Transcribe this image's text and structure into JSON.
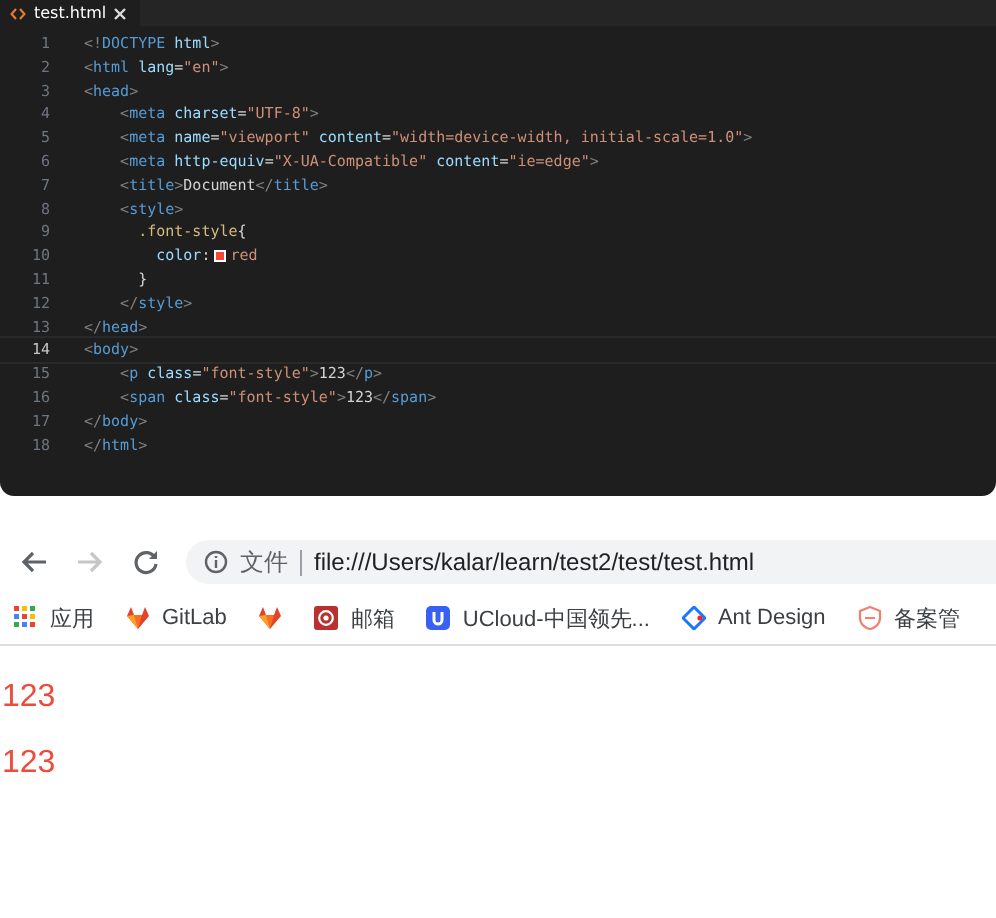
{
  "editor": {
    "tabs": [
      {
        "label": "test.html",
        "selected": true
      }
    ],
    "code_lines": [
      {
        "number": "1",
        "current": false,
        "tokens": [
          {
            "kind": "punct",
            "text": "<!"
          },
          {
            "kind": "tag",
            "text": "DOCTYPE"
          },
          {
            "kind": "attr",
            "text": " html"
          },
          {
            "kind": "punct",
            "text": ">"
          }
        ]
      },
      {
        "number": "2",
        "current": false,
        "tokens": [
          {
            "kind": "punct",
            "text": "<"
          },
          {
            "kind": "tag",
            "text": "html"
          },
          {
            "kind": "attr",
            "text": " lang"
          },
          {
            "kind": "plain",
            "text": "="
          },
          {
            "kind": "string",
            "text": "\"en\""
          },
          {
            "kind": "punct",
            "text": ">"
          }
        ]
      },
      {
        "number": "3",
        "current": false,
        "tokens": [
          {
            "kind": "punct",
            "text": "<"
          },
          {
            "kind": "tag",
            "text": "head"
          },
          {
            "kind": "punct",
            "text": ">"
          }
        ]
      },
      {
        "number": "4",
        "current": false,
        "tokens": [
          {
            "kind": "punct",
            "text": "    <"
          },
          {
            "kind": "tag",
            "text": "meta"
          },
          {
            "kind": "attr",
            "text": " charset"
          },
          {
            "kind": "plain",
            "text": "="
          },
          {
            "kind": "string",
            "text": "\"UTF-8\""
          },
          {
            "kind": "punct",
            "text": ">"
          }
        ]
      },
      {
        "number": "5",
        "current": false,
        "tokens": [
          {
            "kind": "punct",
            "text": "    <"
          },
          {
            "kind": "tag",
            "text": "meta"
          },
          {
            "kind": "attr",
            "text": " name"
          },
          {
            "kind": "plain",
            "text": "="
          },
          {
            "kind": "string",
            "text": "\"viewport\""
          },
          {
            "kind": "attr",
            "text": " content"
          },
          {
            "kind": "plain",
            "text": "="
          },
          {
            "kind": "string",
            "text": "\"width=device-width, initial-scale=1.0\""
          },
          {
            "kind": "punct",
            "text": ">"
          }
        ]
      },
      {
        "number": "6",
        "current": false,
        "tokens": [
          {
            "kind": "punct",
            "text": "    <"
          },
          {
            "kind": "tag",
            "text": "meta"
          },
          {
            "kind": "attr",
            "text": " http-equiv"
          },
          {
            "kind": "plain",
            "text": "="
          },
          {
            "kind": "string",
            "text": "\"X-UA-Compatible\""
          },
          {
            "kind": "attr",
            "text": " content"
          },
          {
            "kind": "plain",
            "text": "="
          },
          {
            "kind": "string",
            "text": "\"ie=edge\""
          },
          {
            "kind": "punct",
            "text": ">"
          }
        ]
      },
      {
        "number": "7",
        "current": false,
        "tokens": [
          {
            "kind": "punct",
            "text": "    <"
          },
          {
            "kind": "tag",
            "text": "title"
          },
          {
            "kind": "punct",
            "text": ">"
          },
          {
            "kind": "plain",
            "text": "Document"
          },
          {
            "kind": "punct",
            "text": "</"
          },
          {
            "kind": "tag",
            "text": "title"
          },
          {
            "kind": "punct",
            "text": ">"
          }
        ]
      },
      {
        "number": "8",
        "current": false,
        "tokens": [
          {
            "kind": "punct",
            "text": "    <"
          },
          {
            "kind": "tag",
            "text": "style"
          },
          {
            "kind": "punct",
            "text": ">"
          }
        ]
      },
      {
        "number": "9",
        "current": false,
        "tokens": [
          {
            "kind": "selector",
            "text": "      .font-style"
          },
          {
            "kind": "plain",
            "text": "{"
          }
        ]
      },
      {
        "number": "10",
        "current": false,
        "tokens": [
          {
            "kind": "attr",
            "text": "        color"
          },
          {
            "kind": "plain",
            "text": ":"
          },
          {
            "kind": "swatch",
            "color": "#f4473a"
          },
          {
            "kind": "string",
            "text": "red"
          }
        ]
      },
      {
        "number": "11",
        "current": false,
        "tokens": [
          {
            "kind": "plain",
            "text": "      }"
          }
        ]
      },
      {
        "number": "12",
        "current": false,
        "tokens": [
          {
            "kind": "punct",
            "text": "    </"
          },
          {
            "kind": "tag",
            "text": "style"
          },
          {
            "kind": "punct",
            "text": ">"
          }
        ]
      },
      {
        "number": "13",
        "current": false,
        "tokens": [
          {
            "kind": "punct",
            "text": "</"
          },
          {
            "kind": "tag",
            "text": "head"
          },
          {
            "kind": "punct",
            "text": ">"
          }
        ]
      },
      {
        "number": "14",
        "current": true,
        "tokens": [
          {
            "kind": "punct",
            "text": "<"
          },
          {
            "kind": "tag",
            "text": "body"
          },
          {
            "kind": "punct",
            "text": ">"
          }
        ]
      },
      {
        "number": "15",
        "current": false,
        "tokens": [
          {
            "kind": "punct",
            "text": "    <"
          },
          {
            "kind": "tag",
            "text": "p"
          },
          {
            "kind": "attr",
            "text": " class"
          },
          {
            "kind": "plain",
            "text": "="
          },
          {
            "kind": "string",
            "text": "\"font-style\""
          },
          {
            "kind": "punct",
            "text": ">"
          },
          {
            "kind": "plain",
            "text": "123"
          },
          {
            "kind": "punct",
            "text": "</"
          },
          {
            "kind": "tag",
            "text": "p"
          },
          {
            "kind": "punct",
            "text": ">"
          }
        ]
      },
      {
        "number": "16",
        "current": false,
        "tokens": [
          {
            "kind": "punct",
            "text": "    <"
          },
          {
            "kind": "tag",
            "text": "span"
          },
          {
            "kind": "attr",
            "text": " class"
          },
          {
            "kind": "plain",
            "text": "="
          },
          {
            "kind": "string",
            "text": "\"font-style\""
          },
          {
            "kind": "punct",
            "text": ">"
          },
          {
            "kind": "plain",
            "text": "123"
          },
          {
            "kind": "punct",
            "text": "</"
          },
          {
            "kind": "tag",
            "text": "span"
          },
          {
            "kind": "punct",
            "text": ">"
          }
        ]
      },
      {
        "number": "17",
        "current": false,
        "tokens": [
          {
            "kind": "punct",
            "text": "</"
          },
          {
            "kind": "tag",
            "text": "body"
          },
          {
            "kind": "punct",
            "text": ">"
          }
        ]
      },
      {
        "number": "18",
        "current": false,
        "tokens": [
          {
            "kind": "punct",
            "text": "</"
          },
          {
            "kind": "tag",
            "text": "html"
          },
          {
            "kind": "punct",
            "text": ">"
          }
        ]
      }
    ]
  },
  "browser": {
    "nav_buttons": [
      {
        "kind": "back",
        "disabled": false
      },
      {
        "kind": "forward",
        "disabled": true
      },
      {
        "kind": "reload",
        "disabled": false
      }
    ],
    "address_bar": {
      "scheme_label": "文件",
      "url": "file:///Users/kalar/learn/test2/test/test.html"
    },
    "bookmarks": [
      {
        "kind": "apps",
        "label": "应用"
      },
      {
        "kind": "fox",
        "label": "GitLab"
      },
      {
        "kind": "fox"
      },
      {
        "kind": "mail",
        "label": "邮箱"
      },
      {
        "kind": "ucloud",
        "label": "UCloud-中国领先..."
      },
      {
        "kind": "diamond",
        "label": "Ant Design"
      },
      {
        "kind": "shield",
        "label": "备案管"
      }
    ],
    "page": [
      {
        "kind": "paragraph",
        "text": "123"
      },
      {
        "kind": "span",
        "text": "123"
      }
    ]
  }
}
